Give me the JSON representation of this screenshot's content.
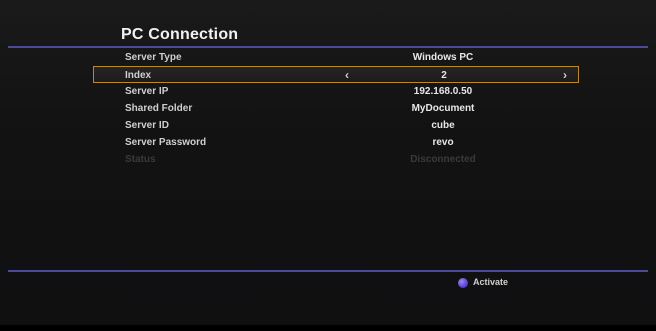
{
  "title": "PC Connection",
  "rows": [
    {
      "label": "Server Type",
      "value": "Windows PC"
    },
    {
      "label": "Index",
      "value": "2"
    },
    {
      "label": "Server IP",
      "value": "192.168.0.50"
    },
    {
      "label": "Shared Folder",
      "value": "MyDocument"
    },
    {
      "label": "Server ID",
      "value": "cube"
    },
    {
      "label": "Server Password",
      "value": "revo"
    },
    {
      "label": "Status",
      "value": "Disconnected"
    }
  ],
  "index_arrows": {
    "left": "‹",
    "right": "›"
  },
  "footer": {
    "activate_label": "Activate"
  },
  "colors": {
    "accent_line": "#4a4a9a",
    "selection_border": "#b8892e",
    "activate_dot": "#5d4ad6"
  },
  "icons": {
    "left": "chevron-left-icon",
    "right": "chevron-right-icon",
    "activate": "purple-button-icon"
  }
}
